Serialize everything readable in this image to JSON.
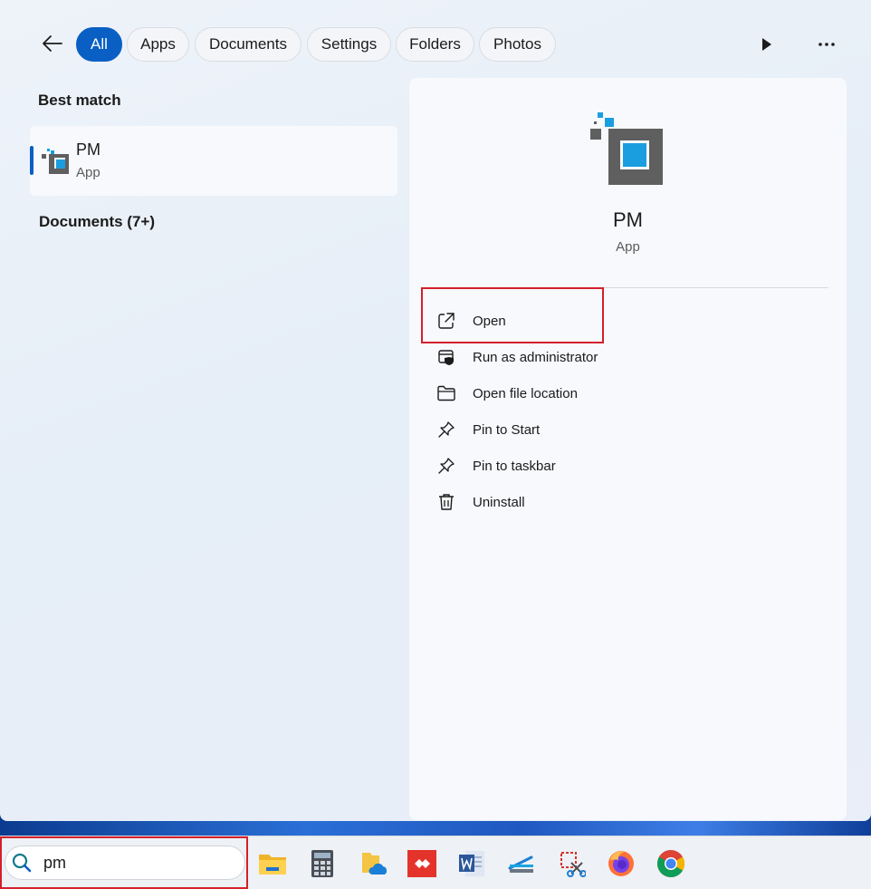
{
  "filters": {
    "tabs": [
      {
        "label": "All",
        "active": true
      },
      {
        "label": "Apps"
      },
      {
        "label": "Documents"
      },
      {
        "label": "Settings"
      },
      {
        "label": "Folders"
      },
      {
        "label": "Photos"
      }
    ]
  },
  "left": {
    "best_match_title": "Best match",
    "best_match": {
      "name": "PM",
      "type": "App"
    },
    "documents_title": "Documents (7+)"
  },
  "detail": {
    "name": "PM",
    "type": "App",
    "actions": [
      {
        "label": "Open",
        "icon": "open-external-icon"
      },
      {
        "label": "Run as administrator",
        "icon": "shield-admin-icon"
      },
      {
        "label": "Open file location",
        "icon": "folder-icon"
      },
      {
        "label": "Pin to Start",
        "icon": "pin-icon"
      },
      {
        "label": "Pin to taskbar",
        "icon": "pin-icon"
      },
      {
        "label": "Uninstall",
        "icon": "trash-icon"
      }
    ]
  },
  "taskbar": {
    "search_value": "pm",
    "apps": [
      "file-explorer",
      "calculator",
      "onedrive-folder",
      "anydesk",
      "word",
      "scanner",
      "snipping-tool",
      "firefox",
      "chrome"
    ]
  },
  "colors": {
    "accent": "#0a5fc4",
    "highlight": "#d3202b",
    "pm_blue": "#1a9ee0",
    "pm_gray": "#5f5f5f"
  }
}
